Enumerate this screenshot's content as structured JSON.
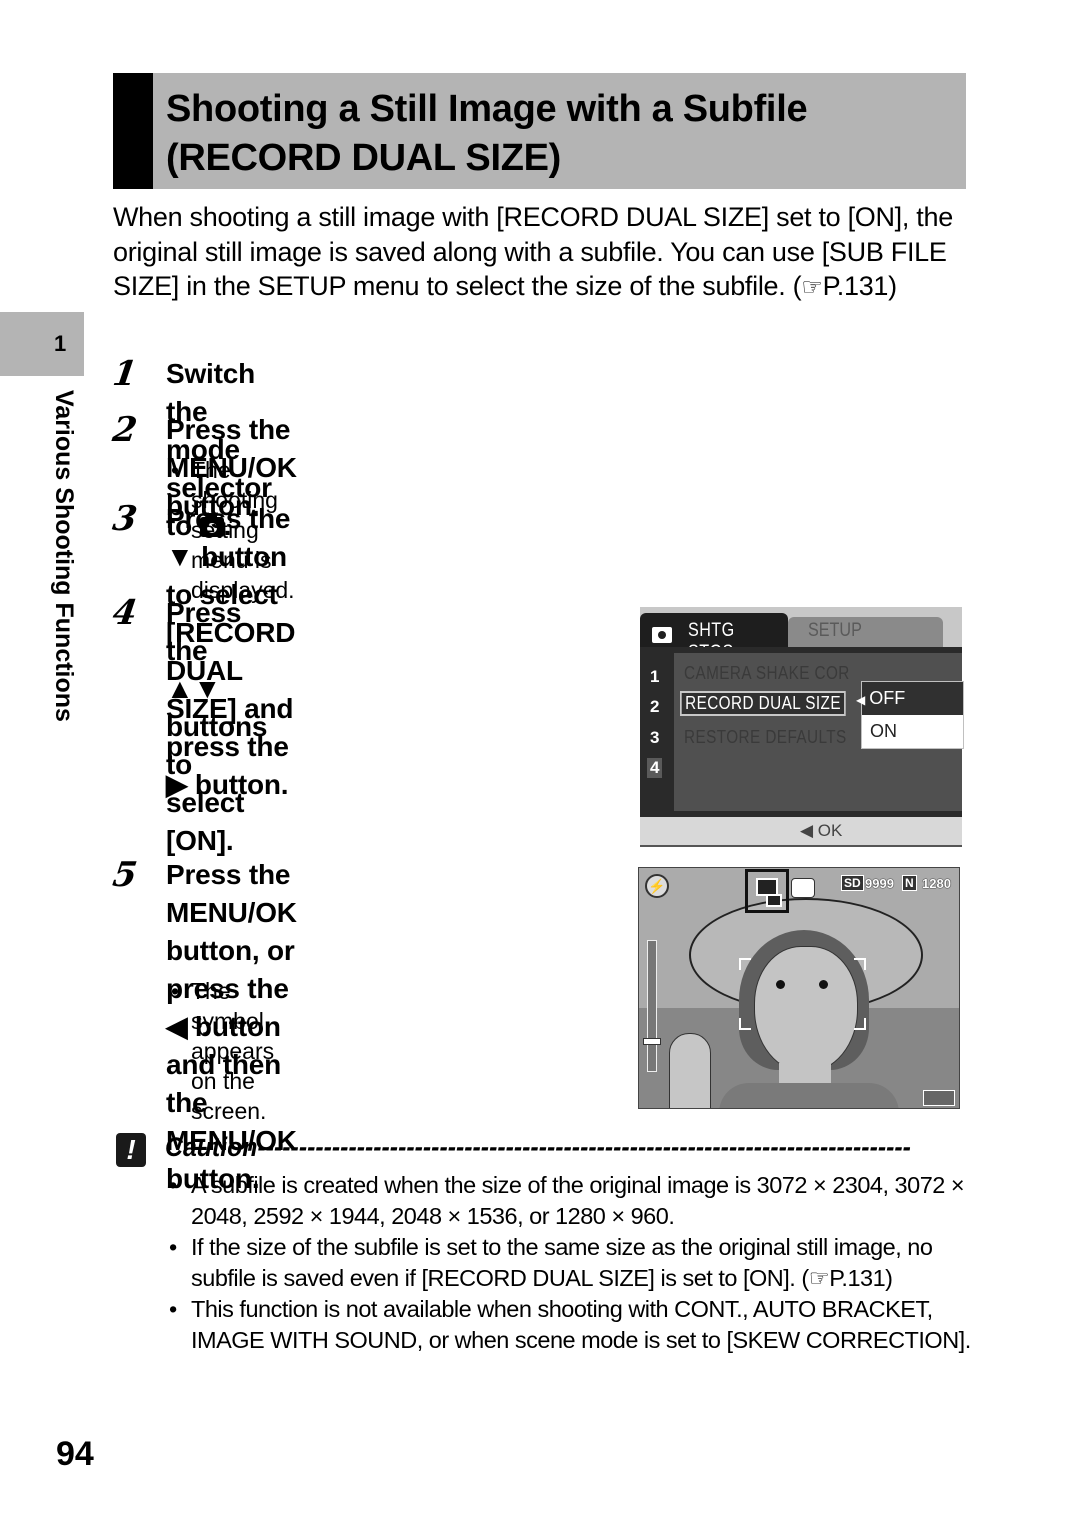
{
  "title": {
    "line1": "Shooting a Still Image with a Subfile",
    "line2": "(RECORD DUAL SIZE)"
  },
  "chapter": {
    "number": "1",
    "title": "Various Shooting Functions"
  },
  "intro": {
    "text": "When shooting a still image with [RECORD DUAL SIZE] set to [ON], the original still image is saved along with a subfile. You can use [SUB FILE SIZE] in the SETUP menu to select the size of the subfile. (",
    "ref_icon": "☞",
    "ref_page": "P.131)"
  },
  "steps": [
    {
      "number": "1",
      "text_before": "Switch the mode selector to ",
      "icon": "camera-mode",
      "text_after": "."
    },
    {
      "number": "2",
      "text": "Press the MENU/OK button.",
      "note": "The shooting setting menu is displayed."
    },
    {
      "number": "3",
      "line1_a": "Press the ",
      "glyph_down": "▼",
      "line1_b": " button to select [RECORD DUAL SIZE] and",
      "line2_a": "press the ",
      "glyph_right": "▶",
      "line2_b": " button."
    },
    {
      "number": "4",
      "line1_a": "Press the ",
      "glyph_updown": "▲▼",
      "line1_b": " buttons to select",
      "line2": "[ON]."
    },
    {
      "number": "5",
      "line1": "Press the MENU/OK button, or",
      "line2_a": "press the ",
      "glyph_left": "◀",
      "line2_b": " button and then the",
      "line3": "MENU/OK button.",
      "note": "The symbol appears on the screen."
    }
  ],
  "menu_screen": {
    "tab_active": "SHTG STGS",
    "tab_inactive": "SETUP",
    "page_numbers": [
      "1",
      "2",
      "3",
      "4"
    ],
    "items": [
      "CAMERA SHAKE COR",
      "RECORD DUAL SIZE",
      "RESTORE DEFAULTS"
    ],
    "selected_item": "RECORD DUAL SIZE",
    "options": [
      "OFF",
      "ON"
    ],
    "option_arrow": "◀",
    "footer": "◀ OK"
  },
  "live_screen": {
    "flash_icon": "⚡",
    "storage": "SD",
    "shots_remaining": "9999",
    "quality": "N",
    "image_size": "1280"
  },
  "caution": {
    "heading": "Caution",
    "dashes": "------------------------------------------------------------------------------------------------",
    "icon": "!",
    "items": [
      {
        "text": "A subfile is created when the size of the original image is 3072 × 2304, 3072 × 2048, 2592 × 1944, 2048 × 1536, or 1280 × 960."
      },
      {
        "text": "If the size of the subfile is set to the same size as the original still image, no subfile is saved even if [RECORD DUAL SIZE] is set to [ON]. (",
        "ref_icon": "☞",
        "ref_page": "P.131)"
      },
      {
        "text": "This function is not available when shooting with CONT., AUTO BRACKET, IMAGE WITH SOUND, or when scene mode is set to [SKEW CORRECTION]."
      }
    ]
  },
  "bullet": "•",
  "page_number": "94"
}
